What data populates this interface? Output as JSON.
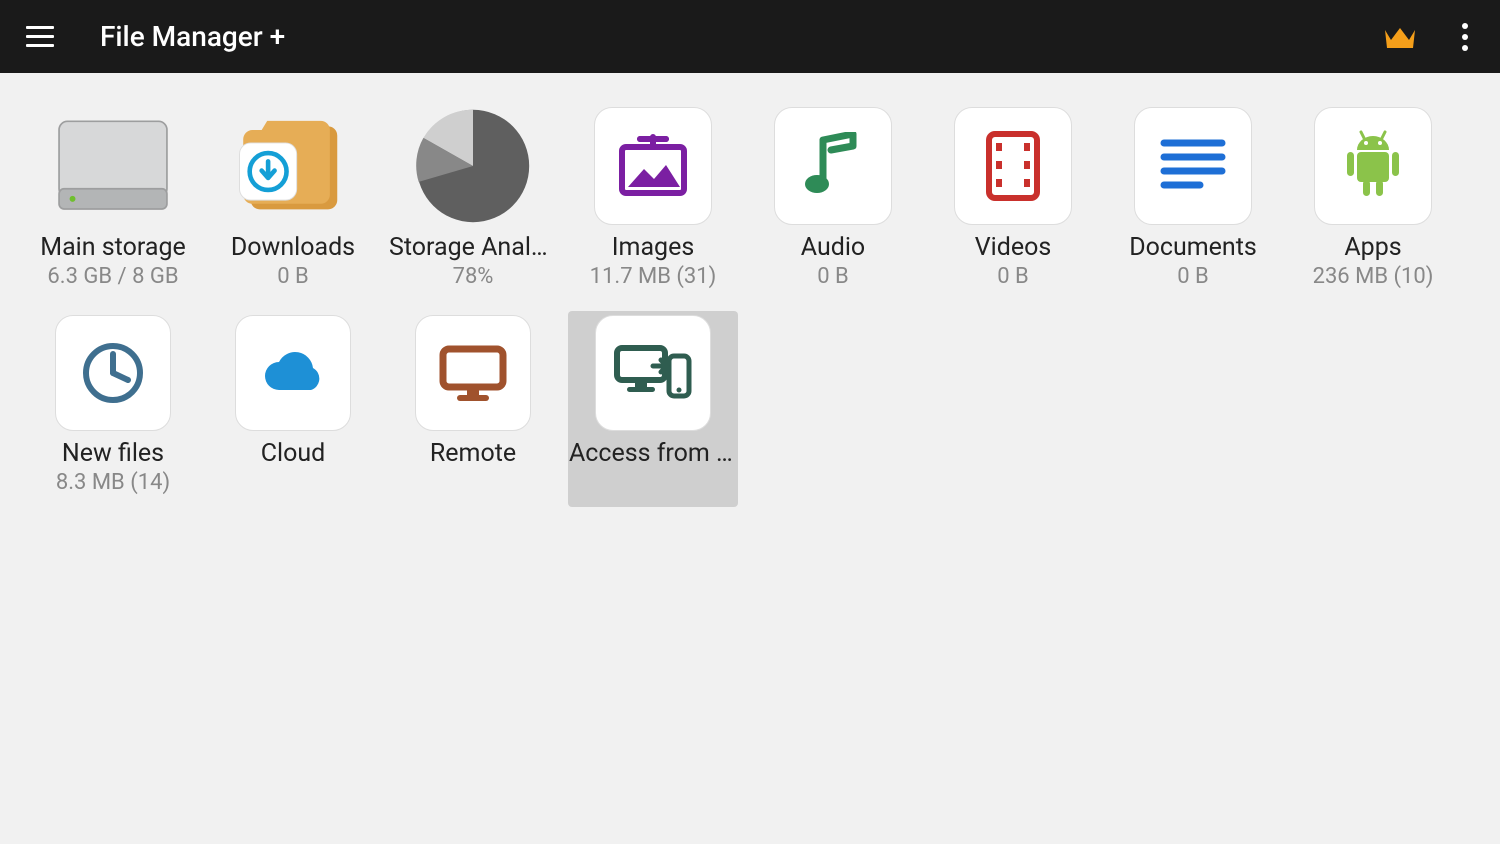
{
  "app_title": "File Manager +",
  "items": [
    {
      "id": "main-storage",
      "label": "Main storage",
      "sub": "6.3 GB / 8 GB"
    },
    {
      "id": "downloads",
      "label": "Downloads",
      "sub": "0 B"
    },
    {
      "id": "storage-analysis",
      "label": "Storage Analysis",
      "sub": "78%"
    },
    {
      "id": "images",
      "label": "Images",
      "sub": "11.7 MB (31)"
    },
    {
      "id": "audio",
      "label": "Audio",
      "sub": "0 B"
    },
    {
      "id": "videos",
      "label": "Videos",
      "sub": "0 B"
    },
    {
      "id": "documents",
      "label": "Documents",
      "sub": "0 B"
    },
    {
      "id": "apps",
      "label": "Apps",
      "sub": "236 MB (10)"
    },
    {
      "id": "new-files",
      "label": "New files",
      "sub": "8.3 MB (14)"
    },
    {
      "id": "cloud",
      "label": "Cloud",
      "sub": ""
    },
    {
      "id": "remote",
      "label": "Remote",
      "sub": ""
    },
    {
      "id": "access-from-pc",
      "label": "Access from network",
      "sub": ""
    }
  ]
}
